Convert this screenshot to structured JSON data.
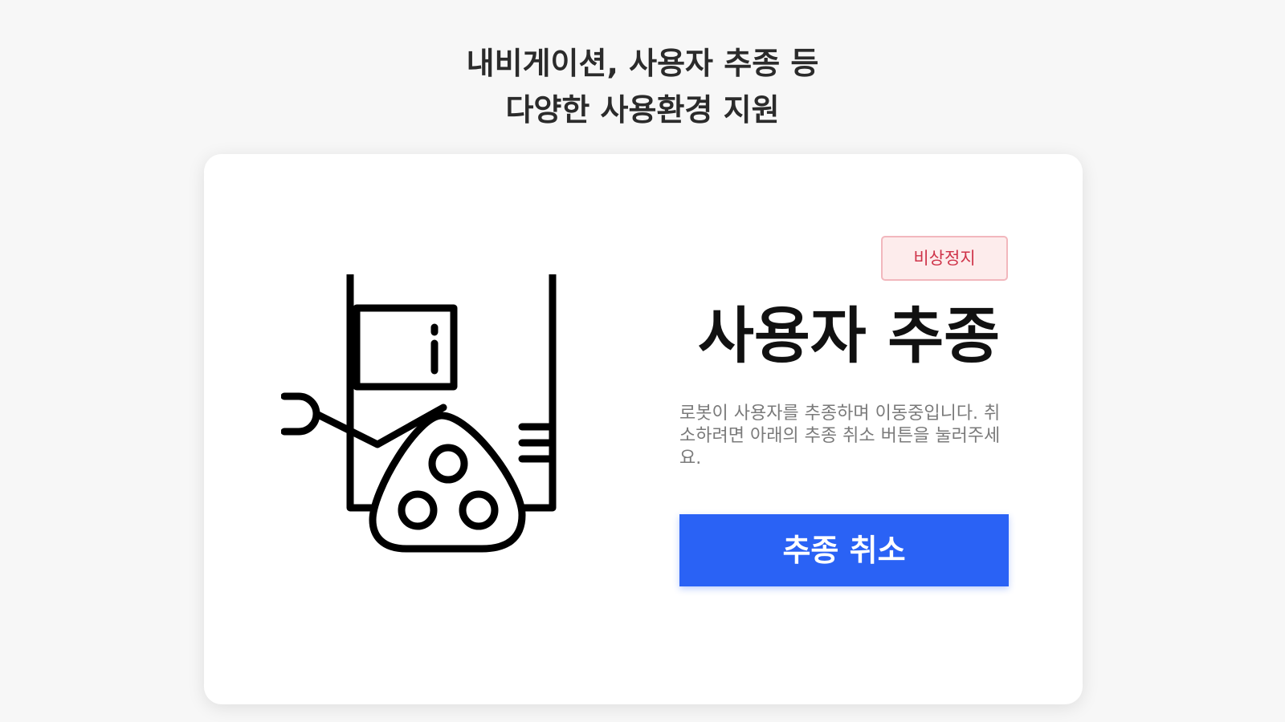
{
  "header": {
    "line1": "내비게이션, 사용자 추종 등",
    "line2": "다양한 사용환경 지원"
  },
  "card": {
    "robot_icon": "robot-icon",
    "emergency_stop_label": "비상정지",
    "title": "사용자 추종",
    "description": "로봇이 사용자를 추종하며 이동중입니다. 취소하려면 아래의 추종 취소 버튼을 눌러주세요.",
    "cancel_button_label": "추종 취소"
  },
  "colors": {
    "primary": "#2a62f5",
    "danger": "#cf3349",
    "danger_bg": "#fdecec"
  }
}
